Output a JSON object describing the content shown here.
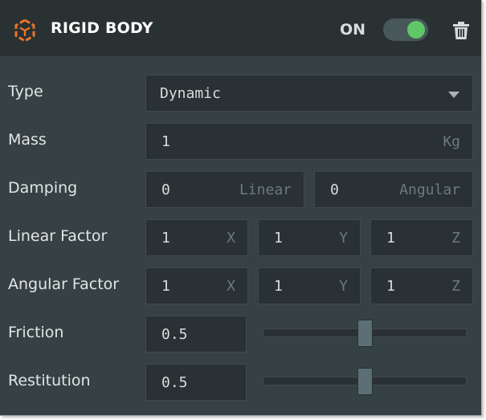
{
  "header": {
    "title": "RIGID BODY",
    "toggle_label": "ON",
    "toggle_on": true,
    "accent_color": "#e8742a",
    "toggle_color": "#5fc766",
    "icon": "cube-physics-icon",
    "delete_icon": "trash-icon"
  },
  "type": {
    "label": "Type",
    "value": "Dynamic",
    "icon": "chevron-down-icon"
  },
  "mass": {
    "label": "Mass",
    "value": "1",
    "unit": "Kg"
  },
  "damping": {
    "label": "Damping",
    "linear": {
      "value": "0",
      "unit": "Linear"
    },
    "angular": {
      "value": "0",
      "unit": "Angular"
    }
  },
  "linear_factor": {
    "label": "Linear Factor",
    "x": {
      "value": "1",
      "unit": "X"
    },
    "y": {
      "value": "1",
      "unit": "Y"
    },
    "z": {
      "value": "1",
      "unit": "Z"
    }
  },
  "angular_factor": {
    "label": "Angular Factor",
    "x": {
      "value": "1",
      "unit": "X"
    },
    "y": {
      "value": "1",
      "unit": "Y"
    },
    "z": {
      "value": "1",
      "unit": "Z"
    }
  },
  "friction": {
    "label": "Friction",
    "value": "0.5",
    "slider_fraction": 0.5
  },
  "restitution": {
    "label": "Restitution",
    "value": "0.5",
    "slider_fraction": 0.5
  }
}
